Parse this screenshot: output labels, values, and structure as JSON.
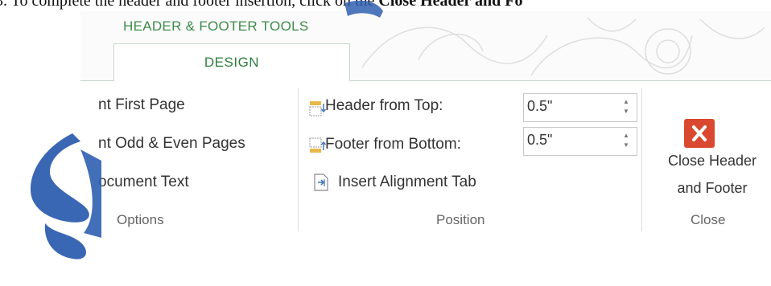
{
  "document": {
    "instruction_number": "3.",
    "instruction_prefix": "To complete the header and footer insertion, click on the",
    "instruction_bold": "Close Header and Fo"
  },
  "ribbon": {
    "context_tab": "HEADER & FOOTER TOOLS",
    "active_tab": "DESIGN",
    "options": {
      "items": [
        "nt First Page",
        "nt Odd & Even Pages",
        "ocument Text"
      ],
      "group_label": "Options"
    },
    "position": {
      "header_label": "Header from Top:",
      "header_value": "0.5\"",
      "footer_label": "Footer from Bottom:",
      "footer_value": "0.5\"",
      "insert_tab_label": "Insert Alignment Tab",
      "group_label": "Position"
    },
    "close": {
      "button_line1": "Close Header",
      "button_line2": "and Footer",
      "group_label": "Close"
    }
  },
  "colors": {
    "accent_green": "#3d8b4a",
    "close_red": "#d9482f",
    "watermark_blue": "#2f5fb0"
  },
  "icons": [
    "header-position-icon",
    "footer-position-icon",
    "insert-alignment-tab-icon",
    "close-x-icon",
    "spinner-up-icon",
    "spinner-down-icon"
  ]
}
